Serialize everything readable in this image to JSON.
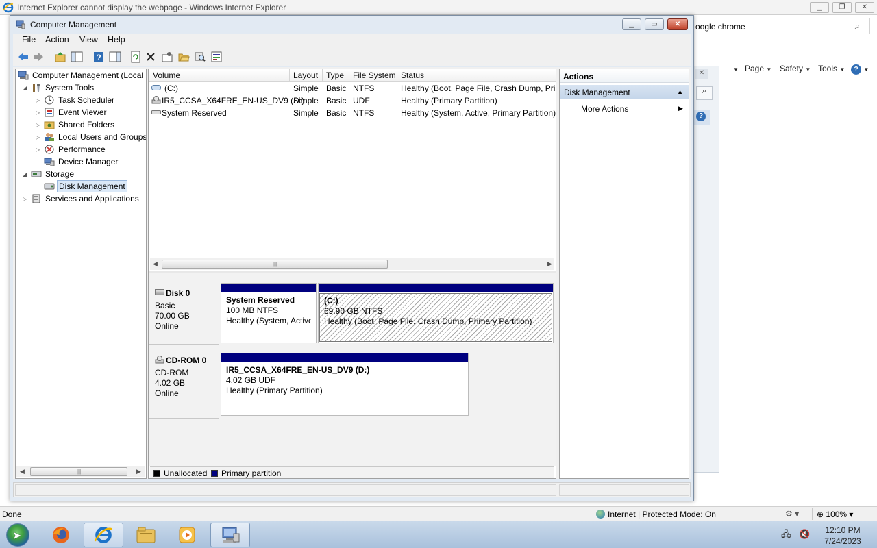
{
  "ie": {
    "window_title": "Internet Explorer cannot display the webpage - Windows Internet Explorer",
    "address_text": "oogle chrome",
    "cmd": {
      "page": "Page",
      "safety": "Safety",
      "tools": "Tools"
    },
    "status_done": "Done",
    "status_zone": "Internet | Protected Mode: On",
    "zoom": "100%"
  },
  "cm": {
    "title": "Computer Management",
    "menu": [
      "File",
      "Action",
      "View",
      "Help"
    ],
    "tree": [
      {
        "label": "Computer Management (Local",
        "level": 0,
        "expander": "",
        "icon": "computer-management-icon"
      },
      {
        "label": "System Tools",
        "level": 1,
        "expander": "◢",
        "icon": "system-tools-icon"
      },
      {
        "label": "Task Scheduler",
        "level": 2,
        "expander": "▷",
        "icon": "task-scheduler-icon"
      },
      {
        "label": "Event Viewer",
        "level": 2,
        "expander": "▷",
        "icon": "event-viewer-icon"
      },
      {
        "label": "Shared Folders",
        "level": 2,
        "expander": "▷",
        "icon": "shared-folders-icon"
      },
      {
        "label": "Local Users and Groups",
        "level": 2,
        "expander": "▷",
        "icon": "local-users-icon"
      },
      {
        "label": "Performance",
        "level": 2,
        "expander": "▷",
        "icon": "performance-icon"
      },
      {
        "label": "Device Manager",
        "level": 2,
        "expander": "",
        "icon": "device-manager-icon"
      },
      {
        "label": "Storage",
        "level": 1,
        "expander": "◢",
        "icon": "storage-icon"
      },
      {
        "label": "Disk Management",
        "level": 2,
        "expander": "",
        "icon": "disk-management-icon",
        "selected": true
      },
      {
        "label": "Services and Applications",
        "level": 1,
        "expander": "▷",
        "icon": "services-icon"
      }
    ],
    "columns": [
      "Volume",
      "Layout",
      "Type",
      "File System",
      "Status"
    ],
    "volumes": [
      {
        "volume": "(C:)",
        "layout": "Simple",
        "type": "Basic",
        "fs": "NTFS",
        "status": "Healthy (Boot, Page File, Crash Dump, Prin"
      },
      {
        "volume": "IR5_CCSA_X64FRE_EN-US_DV9 (D:)",
        "layout": "Simple",
        "type": "Basic",
        "fs": "UDF",
        "status": "Healthy (Primary Partition)"
      },
      {
        "volume": "System Reserved",
        "layout": "Simple",
        "type": "Basic",
        "fs": "NTFS",
        "status": "Healthy (System, Active, Primary Partition)"
      }
    ],
    "disks": [
      {
        "name": "Disk 0",
        "kind": "Basic",
        "size": "70.00 GB",
        "state": "Online",
        "partitions": [
          {
            "name": "System Reserved",
            "size": "100 MB NTFS",
            "status": "Healthy (System, Active,"
          },
          {
            "name": "(C:)",
            "size": "69.90 GB NTFS",
            "status": "Healthy (Boot, Page File, Crash Dump, Primary Partition)"
          }
        ]
      },
      {
        "name": "CD-ROM 0",
        "kind": "CD-ROM",
        "size": "4.02 GB",
        "state": "Online",
        "partitions": [
          {
            "name": "IR5_CCSA_X64FRE_EN-US_DV9  (D:)",
            "size": "4.02 GB UDF",
            "status": "Healthy (Primary Partition)"
          }
        ]
      }
    ],
    "legend": {
      "unallocated": "Unallocated",
      "primary": "Primary partition"
    },
    "colors": {
      "primary_partition": "#00007f",
      "unallocated": "#000000",
      "selection": "#dbe9f8"
    },
    "actions": {
      "header": "Actions",
      "section": "Disk Management",
      "more": "More Actions"
    }
  },
  "taskbar": {
    "time": "12:10 PM",
    "date": "7/24/2023"
  }
}
